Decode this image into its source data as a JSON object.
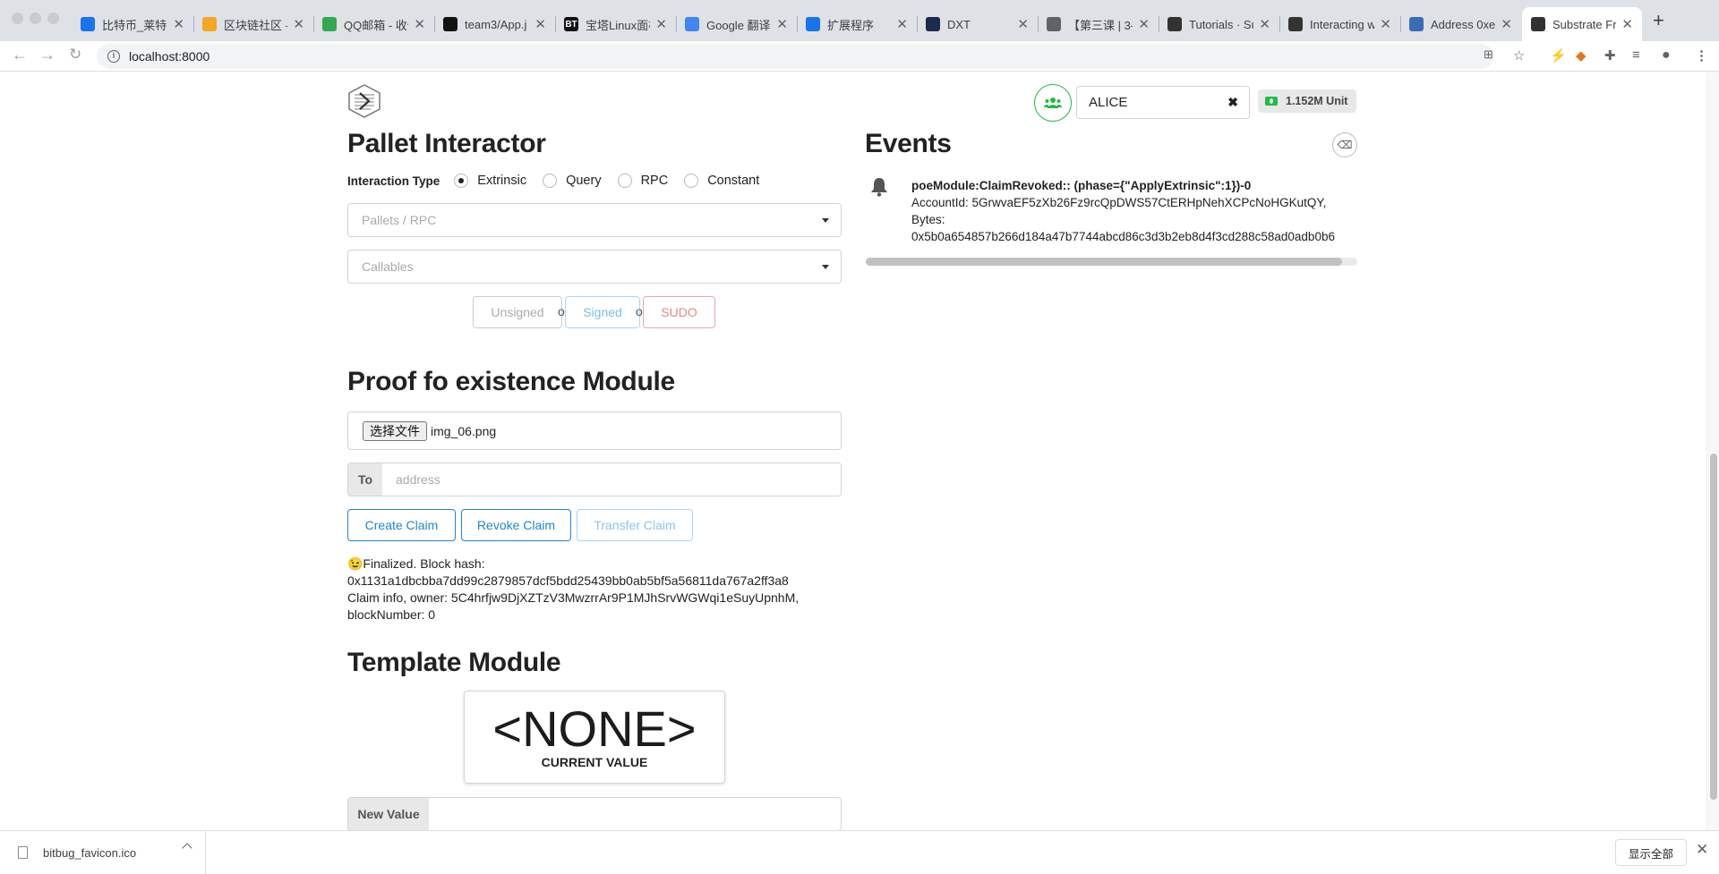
{
  "browser": {
    "tabs": [
      {
        "title": "比特币_莱特币",
        "fav_color": "#1a73e8",
        "fav_text": ""
      },
      {
        "title": "区块链社区 -",
        "fav_color": "#f5a623",
        "fav_text": ""
      },
      {
        "title": "QQ邮箱 - 收件",
        "fav_color": "#34a853",
        "fav_text": ""
      },
      {
        "title": "team3/App.j",
        "fav_color": "#111111",
        "fav_text": ""
      },
      {
        "title": "宝塔Linux面板",
        "fav_color": "#111111",
        "fav_text": "BT"
      },
      {
        "title": "Google 翻译",
        "fav_color": "#4285f4",
        "fav_text": ""
      },
      {
        "title": "扩展程序",
        "fav_color": "#1a73e8",
        "fav_text": ""
      },
      {
        "title": "DXT",
        "fav_color": "#1a2b4c",
        "fav_text": ""
      },
      {
        "title": "【第三课 | 3-",
        "fav_color": "#5f6368",
        "fav_text": ""
      },
      {
        "title": "Tutorials · Su",
        "fav_color": "#333333",
        "fav_text": ""
      },
      {
        "title": "Interacting w",
        "fav_color": "#333333",
        "fav_text": ""
      },
      {
        "title": "Address 0xe",
        "fav_color": "#3c6cb4",
        "fav_text": ""
      },
      {
        "title": "Substrate Fro",
        "fav_color": "#333333",
        "fav_text": ""
      }
    ],
    "url": "localhost:8000"
  },
  "header": {
    "account_name": "ALICE",
    "balance": "1.152M Unit",
    "accent_green": "#21ba45"
  },
  "pallet": {
    "title": "Pallet Interactor",
    "interaction_label": "Interaction Type",
    "radio_options": [
      "Extrinsic",
      "Query",
      "RPC",
      "Constant"
    ],
    "selected": "Extrinsic",
    "pallets_placeholder": "Pallets / RPC",
    "callables_placeholder": "Callables",
    "unsigned_label": "Unsigned",
    "signed_label": "Signed",
    "sudo_label": "SUDO",
    "or_text": "or"
  },
  "poe": {
    "title": "Proof fo existence Module",
    "choose_file_label": "选择文件",
    "file_name": "img_06.png",
    "to_label": "To",
    "address_placeholder": "address",
    "create_label": "Create Claim",
    "revoke_label": "Revoke Claim",
    "transfer_label": "Transfer Claim",
    "status_line1": "😉Finalized. Block hash:",
    "status_line2": "0x1131a1dbcbba7dd99c2879857dcf5bdd25439bb0ab5bf5a56811da767a2ff3a8",
    "status_line3": "Claim info, owner: 5C4hrfjw9DjXZTzV3MwzrrAr9P1MJhSrvWGWqi1eSuyUpnhM,",
    "status_line4": "blockNumber: 0"
  },
  "template": {
    "title": "Template Module",
    "value": "<NONE>",
    "caption": "CURRENT VALUE",
    "new_value_label": "New Value"
  },
  "events": {
    "title": "Events",
    "items": [
      {
        "header": "poeModule:ClaimRevoked:: (phase={\"ApplyExtrinsic\":1})-0",
        "line1": "AccountId: 5GrwvaEF5zXb26Fz9rcQpDWS57CtERHpNehXCPcNoHGKutQY,",
        "line2": "Bytes:",
        "line3": "0x5b0a654857b266d184a47b7744abcd86c3d3b2eb8d4f3cd288c58ad0adb0b6"
      }
    ]
  },
  "downloads": {
    "file_name": "bitbug_favicon.ico",
    "show_all_label": "显示全部"
  }
}
